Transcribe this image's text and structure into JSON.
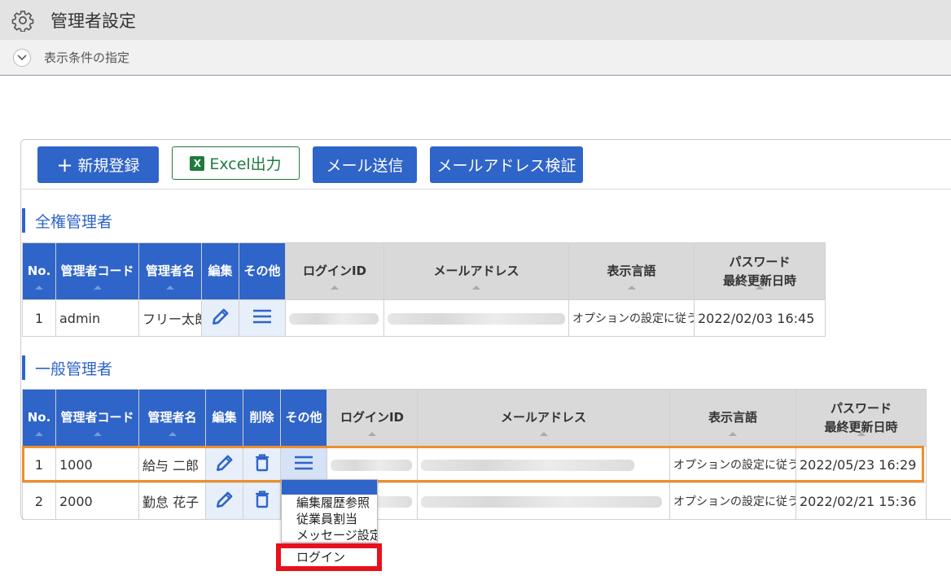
{
  "header": {
    "title": "管理者設定"
  },
  "filter": {
    "label": "表示条件の指定"
  },
  "toolbar": {
    "new_label": "新規登録",
    "excel_label": "Excel出力",
    "mail_label": "メール送信",
    "verify_label": "メールアドレス検証"
  },
  "full_admins": {
    "section_title": "全権管理者",
    "columns": [
      "No.",
      "管理者コード",
      "管理者名",
      "編集",
      "その他",
      "ログインID",
      "メールアドレス",
      "表示言語",
      "パスワード",
      "最終更新日時"
    ],
    "rows": [
      {
        "no": "1",
        "code": "admin",
        "name": "フリー太郎",
        "language": "オプションの設定に従う",
        "updated": "2022/02/03 16:45"
      }
    ]
  },
  "general_admins": {
    "section_title": "一般管理者",
    "columns": [
      "No.",
      "管理者コード",
      "管理者名",
      "編集",
      "削除",
      "その他",
      "ログインID",
      "メールアドレス",
      "表示言語",
      "パスワード",
      "最終更新日時"
    ],
    "rows": [
      {
        "no": "1",
        "code": "1000",
        "name": "給与 二郎",
        "language": "オプションの設定に従う",
        "updated": "2022/05/23 16:29"
      },
      {
        "no": "2",
        "code": "2000",
        "name": "勤怠 花子",
        "language": "オプションの設定に従う",
        "updated": "2022/02/21 15:36"
      }
    ]
  },
  "context_menu": {
    "items": [
      "編集履歴参照",
      "従業員割当",
      "メッセージ設定",
      "ログイン"
    ]
  },
  "colors": {
    "accent": "#2f64c8",
    "selected_row": "#ee8f2e",
    "highlight": "#e8101b",
    "excel": "#1f7a3e"
  }
}
